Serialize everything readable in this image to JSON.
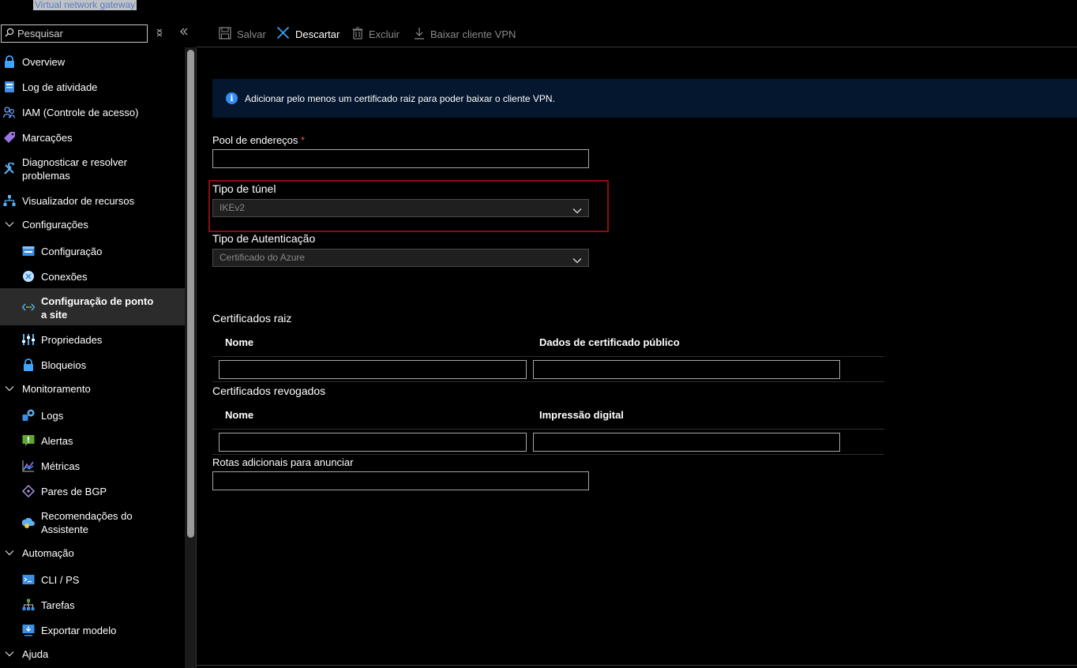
{
  "window_title": "Virtual network gateway",
  "search": {
    "placeholder": "Pesquisar"
  },
  "sidebar": {
    "items": [
      {
        "label": "Overview",
        "icon": "lock-icon"
      },
      {
        "label": "Log de atividade",
        "icon": "log-icon"
      },
      {
        "label": "IAM (Controle de acesso)",
        "icon": "people-icon"
      },
      {
        "label": "Marcações",
        "icon": "tag-icon"
      },
      {
        "label1": "Diagnosticar e resolver",
        "label2": "problemas",
        "icon": "wrench-icon"
      },
      {
        "label": "Visualizador de recursos",
        "icon": "hierarchy-icon"
      },
      {
        "label": "Configurações",
        "icon": "chevron-down-icon"
      },
      {
        "label": "Configuração",
        "icon": "config-icon"
      },
      {
        "label": "Conexões",
        "icon": "connections-icon"
      },
      {
        "label1": "Configuração de ponto",
        "label2": "a site",
        "icon": "point-to-site-icon"
      },
      {
        "label": "Propriedades",
        "icon": "properties-icon"
      },
      {
        "label": "Bloqueios",
        "icon": "lock-icon"
      },
      {
        "label": "Monitoramento",
        "icon": "chevron-down-icon"
      },
      {
        "label": "Logs",
        "icon": "logs-icon"
      },
      {
        "label": "Alertas",
        "icon": "alert-icon"
      },
      {
        "label": "Métricas",
        "icon": "metrics-icon"
      },
      {
        "label": "Pares de BGP",
        "icon": "bgp-icon"
      },
      {
        "label1": "Recomendações do",
        "label2": "Assistente",
        "icon": "advisor-icon"
      },
      {
        "label": "Automação",
        "icon": "chevron-down-icon"
      },
      {
        "label": "CLI / PS",
        "icon": "terminal-icon"
      },
      {
        "label": "Tarefas",
        "icon": "tasks-icon"
      },
      {
        "label": "Exportar modelo",
        "icon": "export-icon"
      },
      {
        "label": "Ajuda",
        "icon": "chevron-down-icon"
      }
    ]
  },
  "toolbar": {
    "save_label": "Salvar",
    "discard_label": "Descartar",
    "delete_label": "Excluir",
    "download_label": "Baixar cliente VPN"
  },
  "info": {
    "message": "Adicionar pelo menos um certificado raiz para poder baixar o cliente VPN."
  },
  "form": {
    "address_pool_label": "Pool de endereços",
    "address_pool_required": "*",
    "tunnel_type_label": "Tipo de túnel",
    "tunnel_type_value": "IKEv2",
    "auth_type_label": "Tipo de Autenticação",
    "auth_type_value": "Certificado do Azure",
    "root_certs_title": "Certificados raiz",
    "root_col_name": "Nome",
    "root_col_data": "Dados de certificado público",
    "revoked_certs_title": "Certificados revogados",
    "revoked_col_name": "Nome",
    "revoked_col_thumbprint": "Impressão digital",
    "additional_routes_label": "Rotas adicionais para anunciar"
  },
  "colors": {
    "accent": "#2f8df7",
    "highlight_border": "#8b0d12",
    "info_bg": "#05172e"
  }
}
